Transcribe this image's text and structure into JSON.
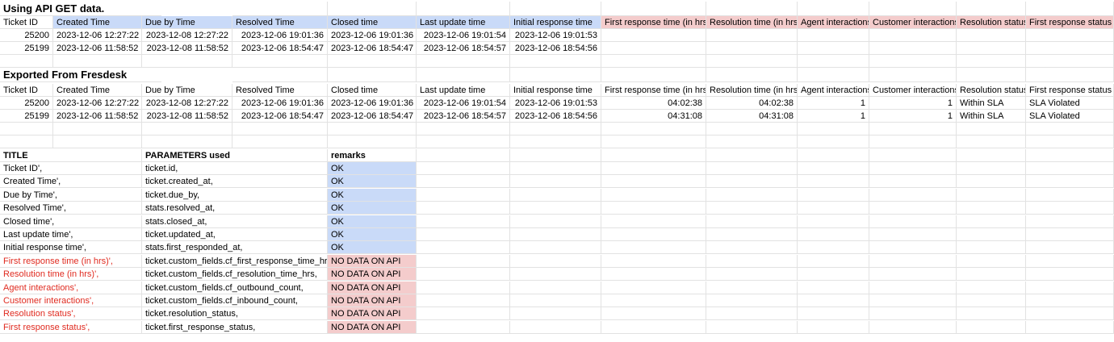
{
  "api_section": {
    "title": "Using API GET data.",
    "headers": [
      "Ticket ID",
      "Created Time",
      "Due by Time",
      "Resolved Time",
      "Closed time",
      "Last update time",
      "Initial response time",
      "First response time (in hrs)",
      "Resolution time (in hrs)",
      "Agent interactions",
      "Customer interactions",
      "Resolution status",
      "First response status"
    ],
    "rows": [
      [
        "25200",
        "2023-12-06 12:27:22",
        "2023-12-08 12:27:22",
        "2023-12-06 19:01:36",
        "2023-12-06 19:01:36",
        "2023-12-06 19:01:54",
        "2023-12-06 19:01:53",
        "",
        "",
        "",
        "",
        "",
        ""
      ],
      [
        "25199",
        "2023-12-06 11:58:52",
        "2023-12-08 11:58:52",
        "2023-12-06 18:54:47",
        "2023-12-06 18:54:47",
        "2023-12-06 18:54:57",
        "2023-12-06 18:54:56",
        "",
        "",
        "",
        "",
        "",
        ""
      ]
    ]
  },
  "export_section": {
    "title": "Exported From Fresdesk",
    "headers": [
      "Ticket ID",
      "Created Time",
      "Due by Time",
      "Resolved Time",
      "Closed time",
      "Last update time",
      "Initial response time",
      "First response time (in hrs)",
      "Resolution time (in hrs)",
      "Agent interactions",
      "Customer interactions",
      "Resolution status",
      "First response status"
    ],
    "rows": [
      [
        "25200",
        "2023-12-06 12:27:22",
        "2023-12-08 12:27:22",
        "2023-12-06 19:01:36",
        "2023-12-06 19:01:36",
        "2023-12-06 19:01:54",
        "2023-12-06 19:01:53",
        "04:02:38",
        "04:02:38",
        "1",
        "1",
        "Within SLA",
        "SLA Violated"
      ],
      [
        "25199",
        "2023-12-06 11:58:52",
        "2023-12-08 11:58:52",
        "2023-12-06 18:54:47",
        "2023-12-06 18:54:47",
        "2023-12-06 18:54:57",
        "2023-12-06 18:54:56",
        "04:31:08",
        "04:31:08",
        "1",
        "1",
        "Within SLA",
        "SLA Violated"
      ]
    ]
  },
  "mapping": {
    "header_title": "TITLE",
    "header_params": "PARAMETERS used",
    "header_remarks": "remarks",
    "rows": [
      {
        "title": "Ticket ID',",
        "param": "ticket.id,",
        "remark": "OK",
        "status": "ok"
      },
      {
        "title": "Created Time',",
        "param": "ticket.created_at,",
        "remark": "OK",
        "status": "ok"
      },
      {
        "title": "Due by Time',",
        "param": "ticket.due_by,",
        "remark": "OK",
        "status": "ok"
      },
      {
        "title": "Resolved Time',",
        "param": "stats.resolved_at,",
        "remark": "OK",
        "status": "ok"
      },
      {
        "title": "Closed time',",
        "param": "stats.closed_at,",
        "remark": "OK",
        "status": "ok"
      },
      {
        "title": "Last update time',",
        "param": "ticket.updated_at,",
        "remark": "OK",
        "status": "ok"
      },
      {
        "title": "Initial response time',",
        "param": "stats.first_responded_at,",
        "remark": "OK",
        "status": "ok"
      },
      {
        "title": "First response time (in hrs)',",
        "param": "ticket.custom_fields.cf_first_response_time_hrs,",
        "remark": "NO DATA ON API",
        "status": "missing"
      },
      {
        "title": "Resolution time (in hrs)',",
        "param": "ticket.custom_fields.cf_resolution_time_hrs,",
        "remark": "NO DATA ON API",
        "status": "missing"
      },
      {
        "title": "Agent interactions',",
        "param": "ticket.custom_fields.cf_outbound_count,",
        "remark": "NO DATA ON API",
        "status": "missing"
      },
      {
        "title": "Customer interactions',",
        "param": "ticket.custom_fields.cf_inbound_count,",
        "remark": "NO DATA ON API",
        "status": "missing"
      },
      {
        "title": "Resolution status',",
        "param": "ticket.resolution_status,",
        "remark": "NO DATA ON API",
        "status": "missing"
      },
      {
        "title": "First response status',",
        "param": "ticket.first_response_status,",
        "remark": "NO DATA ON API",
        "status": "missing"
      }
    ]
  },
  "colors": {
    "ok_fill": "#c9daf8",
    "missing_fill": "#f4cccc",
    "missing_text": "#e02b20",
    "gridline": "#e2e2e2"
  }
}
